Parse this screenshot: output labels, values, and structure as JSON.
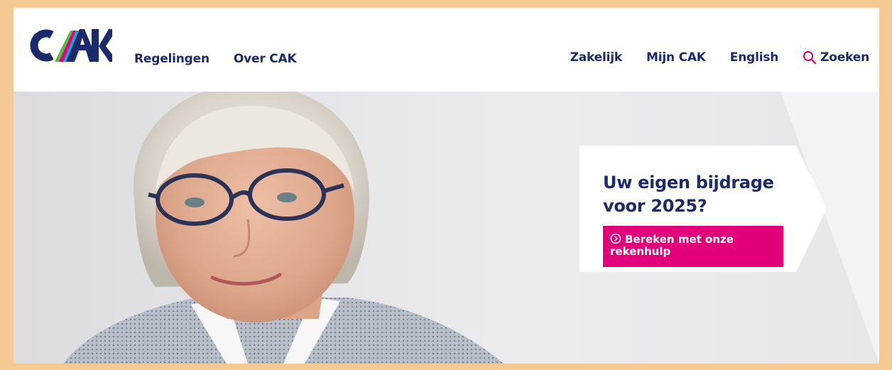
{
  "header": {
    "logo_text": "CAK",
    "nav_left": [
      {
        "label": "Regelingen"
      },
      {
        "label": "Over CAK"
      }
    ],
    "nav_right": [
      {
        "label": "Zakelijk"
      },
      {
        "label": "Mijn CAK"
      },
      {
        "label": "English"
      }
    ],
    "search_label": "Zoeken"
  },
  "hero": {
    "promo_title": "Uw eigen bijdrage voor 2025?",
    "cta_label": "Bereken met onze rekenhulp"
  },
  "colors": {
    "brand_navy": "#1b2a6b",
    "accent_magenta": "#e2007a",
    "frame_border": "#f5c993"
  }
}
